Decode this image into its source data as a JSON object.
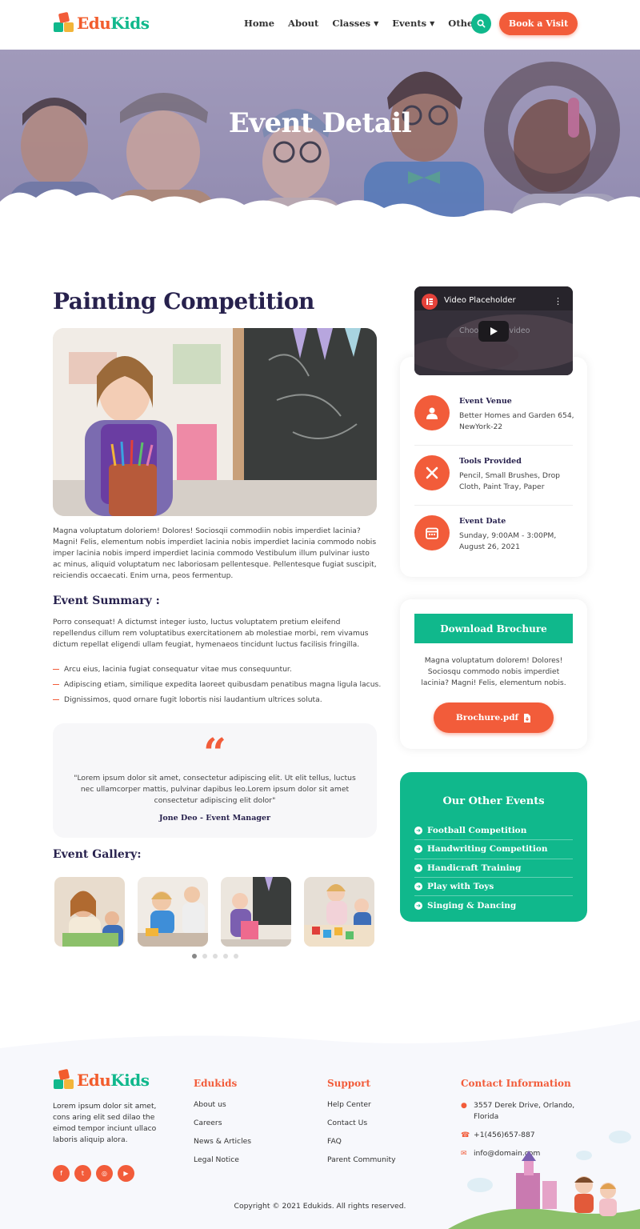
{
  "brand": {
    "name_part1": "Edu",
    "name_part2": "Kids"
  },
  "nav": {
    "items": [
      {
        "label": "Home"
      },
      {
        "label": "About"
      },
      {
        "label": "Classes"
      },
      {
        "label": "Events"
      },
      {
        "label": "Other"
      }
    ],
    "book_label": "Book a Visit"
  },
  "hero": {
    "title": "Event Detail"
  },
  "event": {
    "title": "Painting Competition",
    "intro": "Magna voluptatum doloriem! Dolores! Sociosqii commodiin nobis imperdiet lacinia? Magni! Felis, elementum nobis imperdiet lacinia nobis imperdiet lacinia commodo nobis imper lacinia nobis imperd imperdiet lacinia commodo Vestibulum illum pulvinar iusto ac minus, aliquid voluptatum nec laboriosam pellentesque. Pellentesque fugiat suscipit, reiciendis occaecati. Enim urna, peos fermentup.",
    "summary_heading": "Event Summary :",
    "summary_text": "Porro consequat! A dictumst integer iusto, luctus voluptatem pretium eleifend repellendus cillum rem voluptatibus exercitationem ab molestiae morbi, rem vivamus dictum repellat eligendi ullam feugiat, hymenaeos tincidunt luctus facilisis fringilla.",
    "bullets": [
      "Arcu eius, lacinia fugiat consequatur vitae mus consequuntur.",
      "Adipiscing etiam, similique expedita laoreet quibusdam penatibus magna ligula lacus.",
      "Dignissimos, quod ornare fugit lobortis nisi laudantium ultrices soluta."
    ],
    "quote_mark": "“",
    "quote_text": "\"Lorem ipsum dolor sit amet, consectetur adipiscing elit. Ut elit tellus, luctus nec ullamcorper mattis, pulvinar dapibus leo.Lorem ipsum dolor sit amet consectetur adipiscing elit dolor\"",
    "quote_author": "Jone Deo - Event Manager",
    "gallery_heading": "Event Gallery:"
  },
  "video": {
    "title": "Video Placeholder",
    "subtitle": "Choose your video"
  },
  "info": [
    {
      "label": "Event Venue",
      "value": "Better Homes and Garden 654, NewYork-22"
    },
    {
      "label": "Tools Provided",
      "value": "Pencil, Small Brushes, Drop Cloth, Paint Tray, Paper"
    },
    {
      "label": "Event Date",
      "value": "Sunday, 9:00AM - 3:00PM, August 26, 2021"
    }
  ],
  "brochure": {
    "heading": "Download Brochure",
    "text": "Magna voluptatum dolorem! Dolores! Sociosqu commodo nobis imperdiet lacinia? Magni! Felis, elementum nobis.",
    "button": "Brochure.pdf"
  },
  "other_events": {
    "title": "Our Other Events",
    "items": [
      "Football Competition",
      "Handwriting Competition",
      "Handicraft Training",
      "Play with Toys",
      "Singing & Dancing"
    ]
  },
  "footer": {
    "about": "Lorem ipsum dolor sit amet, cons aring elit sed dilao the eimod tempor inciunt ullaco laboris aliquip alora.",
    "col1": {
      "title": "Edukids",
      "links": [
        "About us",
        "Careers",
        "News & Articles",
        "Legal Notice"
      ]
    },
    "col2": {
      "title": "Support",
      "links": [
        "Help Center",
        "Contact Us",
        "FAQ",
        "Parent Community"
      ]
    },
    "contact": {
      "title": "Contact Information",
      "address": "3557 Derek Drive, Orlando, Florida",
      "phone": "+1(456)657-887",
      "email": "info@domain.com"
    },
    "copyright": "Copyright © 2021 Edukids. All rights reserved."
  },
  "colors": {
    "accent": "#f25c3a",
    "green": "#10b88c",
    "navy": "#27214d"
  }
}
